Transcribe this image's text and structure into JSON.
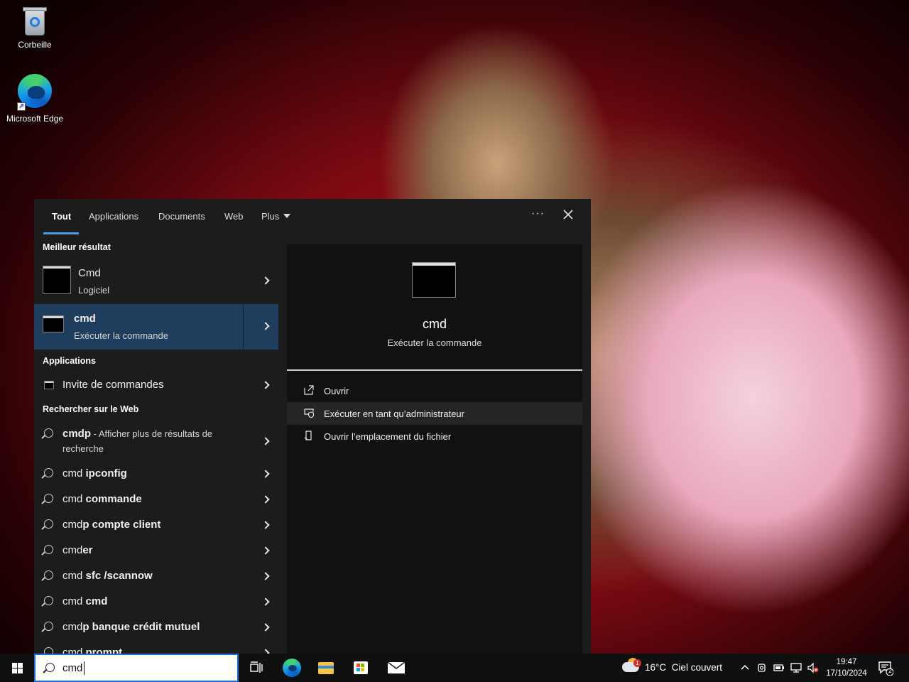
{
  "desktop": {
    "icons": [
      {
        "label": "Corbeille",
        "icon": "recycle-bin-icon"
      },
      {
        "label": "Microsoft Edge",
        "icon": "edge-icon"
      }
    ]
  },
  "search_panel": {
    "tabs": [
      {
        "label": "Tout",
        "active": true
      },
      {
        "label": "Applications"
      },
      {
        "label": "Documents"
      },
      {
        "label": "Web"
      },
      {
        "label": "Plus"
      }
    ],
    "more_options": "···",
    "best_match": {
      "header": "Meilleur résultat",
      "items": [
        {
          "title": "Cmd",
          "subtitle": "Logiciel"
        },
        {
          "title": "cmd",
          "subtitle": "Exécuter la commande",
          "selected": true
        }
      ]
    },
    "apps": {
      "header": "Applications",
      "items": [
        {
          "title": "Invite de commandes"
        }
      ]
    },
    "web": {
      "header": "Rechercher sur le Web",
      "first": {
        "prefix": "cmdp",
        "description": " - Afficher plus de résultats de",
        "description_line2": "recherche"
      },
      "suggestions": [
        {
          "prefix": "cmd ",
          "bold": "ipconfig"
        },
        {
          "prefix": "cmd ",
          "bold": "commande"
        },
        {
          "prefix": "cmd",
          "bold": "p compte client"
        },
        {
          "prefix": "cmd",
          "bold": "er"
        },
        {
          "prefix": "cmd ",
          "bold": "sfc /scannow"
        },
        {
          "prefix": "cmd ",
          "bold": "cmd"
        },
        {
          "prefix": "cmd",
          "bold": "p banque crédit mutuel"
        },
        {
          "prefix": "cmd ",
          "bold": "prompt"
        }
      ]
    },
    "preview": {
      "title": "cmd",
      "subtitle": "Exécuter la commande",
      "actions": [
        {
          "label": "Ouvrir",
          "icon": "open-icon"
        },
        {
          "label": "Exécuter en tant qu’administrateur",
          "icon": "shield-icon",
          "hover": true
        },
        {
          "label": "Ouvrir l’emplacement du fichier",
          "icon": "file-location-icon"
        }
      ]
    }
  },
  "taskbar": {
    "search_query": "cmd",
    "apps": [
      "task-view-icon",
      "edge-icon",
      "file-explorer-icon",
      "store-icon",
      "mail-icon"
    ],
    "weather": {
      "temp": "16°C",
      "condition": "Ciel couvert",
      "badge": "1"
    },
    "clock": {
      "time": "19:47",
      "date": "17/10/2024"
    },
    "notifications": "2"
  },
  "colors": {
    "accent": "#4aa0e6",
    "selected": "#1f3d5c",
    "panel": "#1c1c1c",
    "preview": "#111111"
  }
}
